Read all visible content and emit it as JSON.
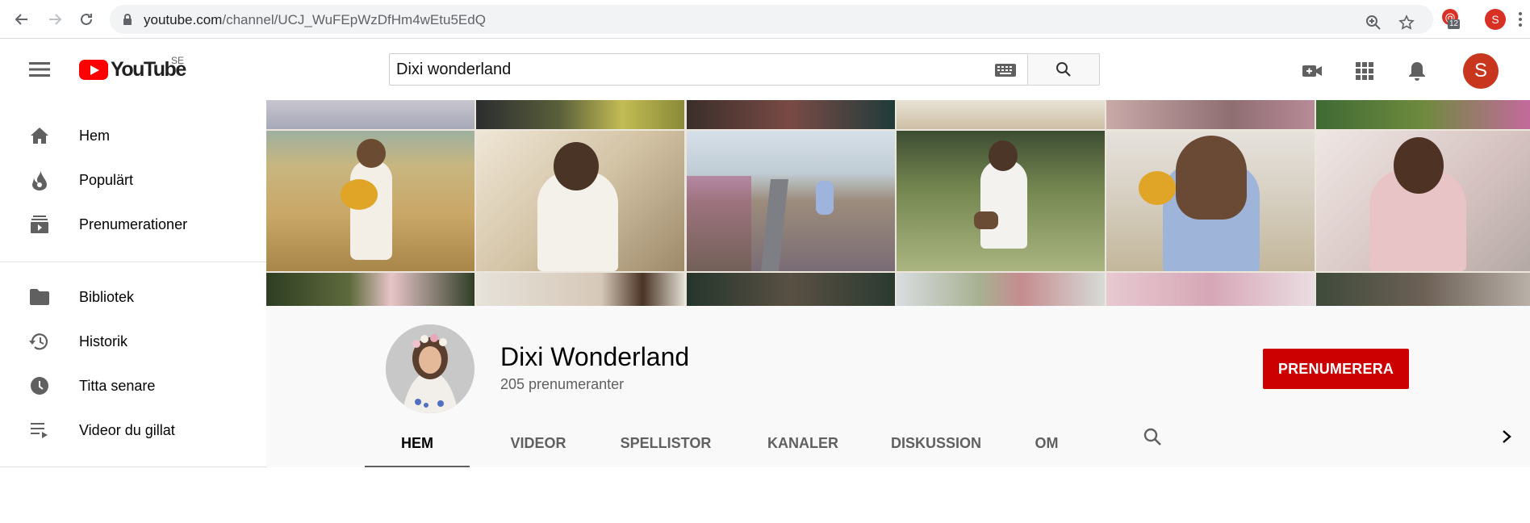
{
  "browser": {
    "url_host": "youtube.com",
    "url_path": "/channel/UCJ_WuFEpWzDfHm4wEtu5EdQ",
    "extension_count": "12",
    "profile_initial": "S"
  },
  "masthead": {
    "logo_text": "YouTube",
    "country_code": "SE",
    "search_value": "Dixi wonderland",
    "avatar_initial": "S"
  },
  "sidebar": {
    "items": [
      {
        "label": "Hem",
        "icon": "home-icon"
      },
      {
        "label": "Populärt",
        "icon": "flame-icon"
      },
      {
        "label": "Prenumerationer",
        "icon": "subscriptions-icon"
      },
      {
        "label": "Bibliotek",
        "icon": "folder-icon"
      },
      {
        "label": "Historik",
        "icon": "history-icon"
      },
      {
        "label": "Titta senare",
        "icon": "clock-icon"
      },
      {
        "label": "Videor du gillat",
        "icon": "playlist-icon"
      }
    ]
  },
  "channel": {
    "name": "Dixi Wonderland",
    "subscribers": "205 prenumeranter",
    "subscribe_label": "PRENUMERERA",
    "tabs": [
      {
        "label": "HEM",
        "active": true
      },
      {
        "label": "VIDEOR",
        "active": false
      },
      {
        "label": "SPELLISTOR",
        "active": false
      },
      {
        "label": "KANALER",
        "active": false
      },
      {
        "label": "DISKUSSION",
        "active": false
      },
      {
        "label": "OM",
        "active": false
      }
    ]
  },
  "colors": {
    "accent_red": "#cc0000",
    "logo_red": "#ff0000",
    "header_bg": "#f9f9f9"
  }
}
